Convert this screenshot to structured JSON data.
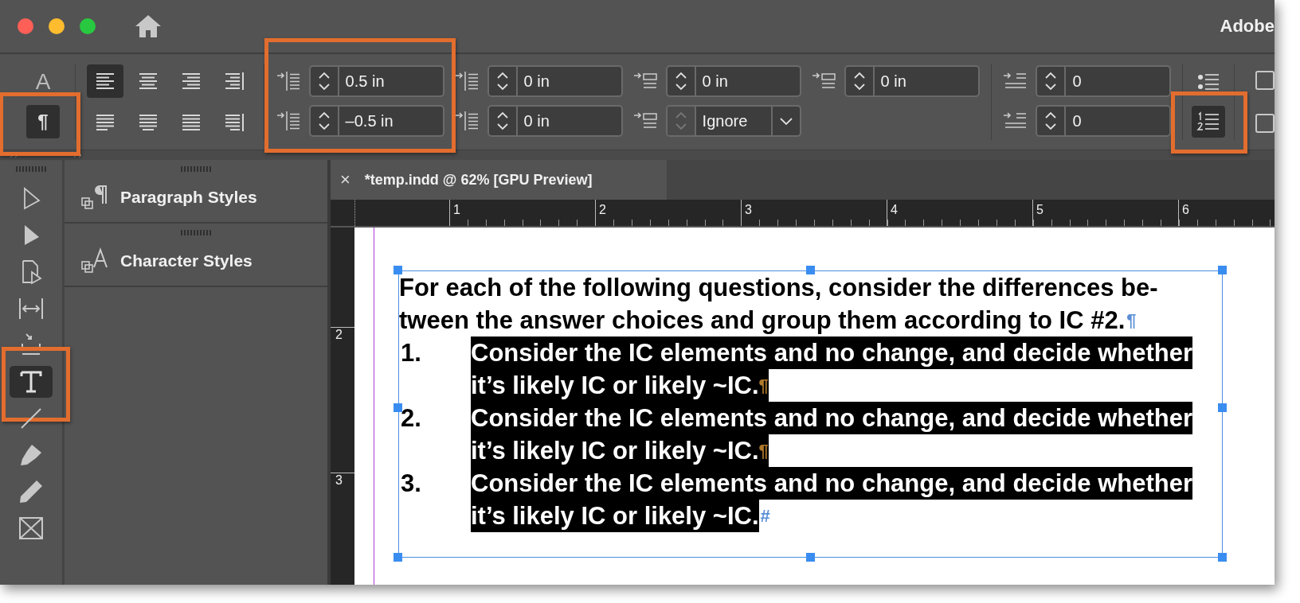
{
  "window": {
    "title": "Adobe"
  },
  "control_panel": {
    "mode_buttons": [
      {
        "label": "A",
        "selected": false,
        "callout": false
      },
      {
        "label": "¶",
        "selected": true,
        "callout": true
      }
    ],
    "alignment_buttons": [
      {
        "kind": "left",
        "selected": true
      },
      {
        "kind": "center",
        "selected": false
      },
      {
        "kind": "right",
        "selected": false
      },
      {
        "kind": "toward-spine",
        "selected": false
      },
      {
        "kind": "justify-left",
        "selected": false
      },
      {
        "kind": "justify-center",
        "selected": false
      },
      {
        "kind": "justify-all",
        "selected": false
      },
      {
        "kind": "away-spine",
        "selected": false
      }
    ],
    "field_columns": [
      {
        "callout": true,
        "fields": [
          {
            "kind": "spinner",
            "value": "0.5 in"
          },
          {
            "kind": "spinner",
            "value": "–0.5 in"
          }
        ]
      },
      {
        "callout": false,
        "fields": [
          {
            "kind": "spinner",
            "value": "0 in"
          },
          {
            "kind": "spinner",
            "value": "0 in"
          }
        ]
      },
      {
        "callout": false,
        "fields": [
          {
            "kind": "spinner",
            "value": "0 in"
          },
          {
            "kind": "dropdown",
            "value": "Ignore"
          }
        ]
      },
      {
        "callout": false,
        "fields": [
          {
            "kind": "spinner",
            "value": "0 in"
          }
        ]
      },
      {
        "callout": false,
        "fields": [
          {
            "kind": "spinner",
            "value": "0"
          },
          {
            "kind": "spinner",
            "value": "0"
          }
        ]
      }
    ],
    "list_buttons": [
      {
        "kind": "bulleted",
        "selected": false,
        "callout": false
      },
      {
        "kind": "numbered",
        "selected": true,
        "callout": true
      }
    ],
    "checkboxes": [
      {
        "checked": false
      },
      {
        "checked": false
      }
    ]
  },
  "tools": [
    {
      "kind": "selection",
      "selected": false,
      "callout": false
    },
    {
      "kind": "direct-selection",
      "selected": false,
      "callout": false
    },
    {
      "kind": "page",
      "selected": false,
      "callout": false
    },
    {
      "kind": "gap",
      "selected": false,
      "callout": false
    },
    {
      "kind": "collector",
      "selected": false,
      "callout": false
    },
    {
      "kind": "type",
      "selected": true,
      "callout": true
    },
    {
      "kind": "line",
      "selected": false,
      "callout": false
    },
    {
      "kind": "pen",
      "selected": false,
      "callout": false
    },
    {
      "kind": "pencil",
      "selected": false,
      "callout": false
    },
    {
      "kind": "frame",
      "selected": false,
      "callout": false
    }
  ],
  "panels": [
    {
      "kind": "paragraph",
      "label": "Paragraph Styles"
    },
    {
      "kind": "character",
      "label": "Character Styles"
    }
  ],
  "document_tab": {
    "close": "×",
    "title": "*temp.indd @ 62% [GPU Preview]"
  },
  "ruler": {
    "horizontal": [
      "1",
      "2",
      "3",
      "4",
      "5",
      "6"
    ],
    "vertical": [
      "2",
      "3"
    ]
  },
  "text_frame": {
    "paragraphs": [
      {
        "kind": "body",
        "lines": [
          "For each of the following questions, consider the differences be-",
          "tween the answer choices and group them according to IC #2."
        ],
        "end_mark": "¶",
        "selected": false,
        "mark_selected": false
      },
      {
        "kind": "list",
        "number": "1.",
        "lines": [
          "Consider the IC elements and no change, and decide whether",
          "it’s likely IC or likely ~IC."
        ],
        "end_mark": "¶",
        "selected": true,
        "mark_selected": true
      },
      {
        "kind": "list",
        "number": "2.",
        "lines": [
          "Consider the IC elements and no change, and decide whether",
          "it’s likely IC or likely ~IC."
        ],
        "end_mark": "¶",
        "selected": true,
        "mark_selected": true
      },
      {
        "kind": "list",
        "number": "3.",
        "lines": [
          "Consider the IC elements and no change, and decide whether",
          "it’s likely IC or likely ~IC."
        ],
        "end_mark": "#",
        "selected": true,
        "mark_selected": false
      }
    ]
  }
}
